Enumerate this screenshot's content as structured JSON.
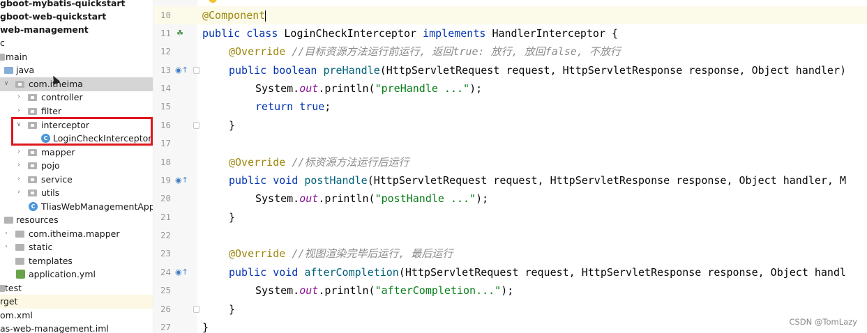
{
  "tree": {
    "items": [
      {
        "label": "gboot-mybatis-quickstart",
        "bold": true
      },
      {
        "label": "gboot-web-quickstart",
        "bold": true
      },
      {
        "label": "web-management",
        "bold": true
      },
      {
        "label": "c"
      },
      {
        "label": "main"
      },
      {
        "label": "java"
      },
      {
        "label": "com.itheima"
      },
      {
        "label": "controller"
      },
      {
        "label": "filter"
      },
      {
        "label": "interceptor"
      },
      {
        "label": "LoginCheckInterceptor"
      },
      {
        "label": "mapper"
      },
      {
        "label": "pojo"
      },
      {
        "label": "service"
      },
      {
        "label": "utils"
      },
      {
        "label": "TliasWebManagementApplic"
      },
      {
        "label": "resources"
      },
      {
        "label": "com.itheima.mapper"
      },
      {
        "label": "static"
      },
      {
        "label": "templates"
      },
      {
        "label": "application.yml"
      },
      {
        "label": "test"
      },
      {
        "label": "rget"
      },
      {
        "label": "om.xml"
      },
      {
        "label": "as-web-management.iml"
      }
    ]
  },
  "editor": {
    "lines": [
      {
        "n": "10"
      },
      {
        "n": "11"
      },
      {
        "n": "12"
      },
      {
        "n": "13"
      },
      {
        "n": "14"
      },
      {
        "n": "15"
      },
      {
        "n": "16"
      },
      {
        "n": "17"
      },
      {
        "n": "18"
      },
      {
        "n": "19"
      },
      {
        "n": "20"
      },
      {
        "n": "21"
      },
      {
        "n": "22"
      },
      {
        "n": "23"
      },
      {
        "n": "24"
      },
      {
        "n": "25"
      },
      {
        "n": "26"
      },
      {
        "n": "27"
      }
    ],
    "code": {
      "ann_component": "@Component",
      "kw_public": "public",
      "kw_class": "class",
      "kw_implements": "implements",
      "kw_boolean": "boolean",
      "kw_void": "void",
      "kw_return": "return",
      "kw_true": "true",
      "class_name": "LoginCheckInterceptor",
      "iface_name": "HandlerInterceptor {",
      "ann_override": "@Override",
      "cmt_pre": "//目标资源方法运行前运行, 返回true: 放行, 放回false, 不放行",
      "cmt_post": "//标资源方法运行后运行",
      "cmt_after": "//视图渲染完毕后运行, 最后运行",
      "m_pre": "preHandle",
      "m_post": "postHandle",
      "m_after": "afterCompletion",
      "params_pre": "(HttpServletRequest request, HttpServletResponse response, Object handler)",
      "params_post": "(HttpServletRequest request, HttpServletResponse response, Object handler, M",
      "params_after": "(HttpServletRequest request, HttpServletResponse response, Object handl",
      "sys": "System.",
      "out": "out",
      "println": ".println(",
      "s_pre": "\"preHandle ...\"",
      "s_post": "\"postHandle ...\"",
      "s_after": "\"afterCompletion...\"",
      "end_call": ");",
      "semi": ";",
      "brace": "}"
    }
  },
  "watermark": "CSDN @TomLazy",
  "colors": {
    "selection_box": "#e0161b",
    "keyword": "#0033b3",
    "annotation": "#9e880d",
    "string": "#067d17"
  }
}
